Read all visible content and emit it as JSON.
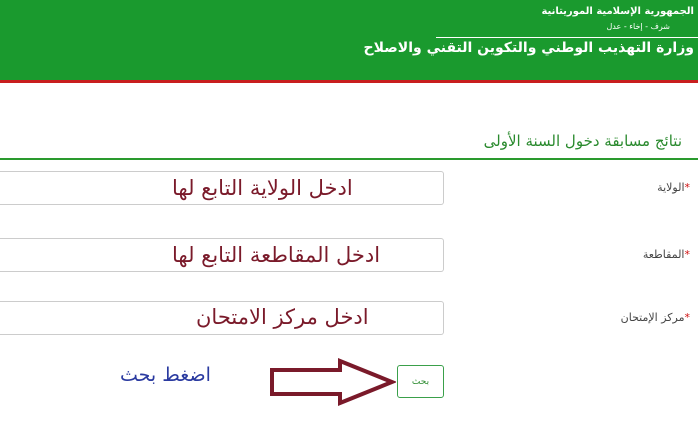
{
  "header": {
    "republic": "الجمهورية الإسلامية الموريتانية",
    "motto": "شرف - إخاء - عدل",
    "ministry": "وزارة التهذيب الوطني والتكوين التقني والاصلاح"
  },
  "page": {
    "title": "نتائج مسابقة دخول السنة الأولى"
  },
  "form": {
    "required_mark": "*",
    "fields": [
      {
        "label": "الولاية",
        "overlay": "ادخل الولاية التابع لها"
      },
      {
        "label": "المقاطعة",
        "overlay": "ادخل المقاطعة التابع لها"
      },
      {
        "label": "مركز الإمتحان",
        "overlay": "ادخل مركز الامتحان"
      }
    ],
    "search_button": "بحث"
  },
  "annotation": {
    "press_hint": "اضغط بحث",
    "arrow_color": "#7a1a2a"
  },
  "colors": {
    "header_green": "#1a9a2e",
    "header_red": "#c81e1e",
    "title_green": "#2a8a2e"
  }
}
